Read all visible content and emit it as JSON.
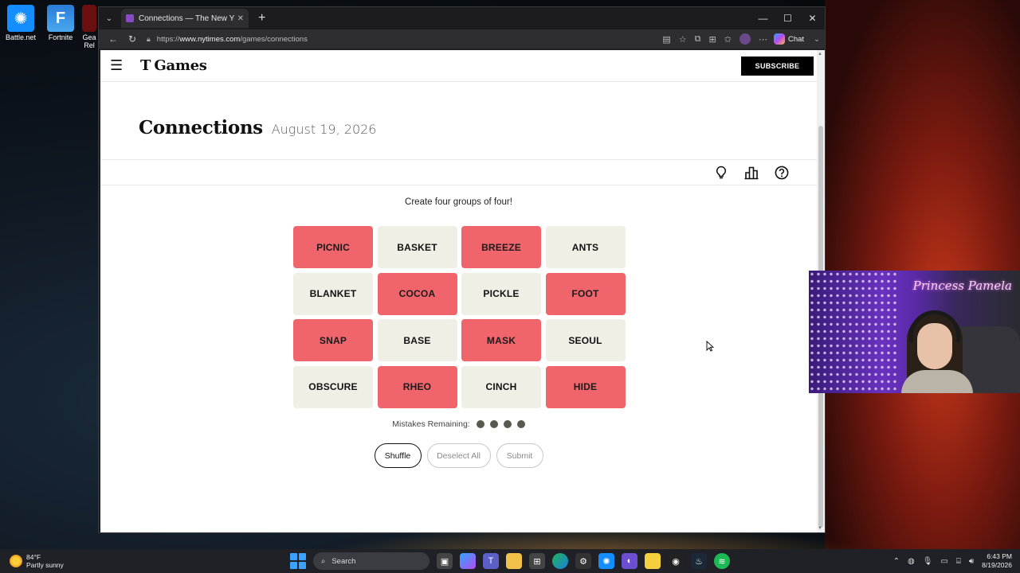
{
  "desktop": {
    "icons": [
      {
        "label": "Battle.net",
        "icon": "battlenet-icon"
      },
      {
        "label": "Fortnite",
        "icon": "fortnite-icon"
      },
      {
        "label": "Gea Rel",
        "icon": "gears-icon"
      }
    ]
  },
  "browser": {
    "tab_title": "Connections — The New York Times",
    "url_prefix": "https://",
    "url_domain": "www.nytimes.com",
    "url_path": "/games/connections",
    "chat_label": "Chat"
  },
  "header": {
    "logo_mark": "T",
    "logo_text": "Games",
    "subscribe_label": "SUBSCRIBE"
  },
  "game": {
    "title": "Connections",
    "date": "August 19, 2026",
    "instructions": "Create four groups of four!",
    "cards": [
      {
        "word": "PICNIC",
        "selected": true
      },
      {
        "word": "BASKET",
        "selected": false
      },
      {
        "word": "BREEZE",
        "selected": true
      },
      {
        "word": "ANTS",
        "selected": false
      },
      {
        "word": "BLANKET",
        "selected": false
      },
      {
        "word": "COCOA",
        "selected": true
      },
      {
        "word": "PICKLE",
        "selected": false
      },
      {
        "word": "FOOT",
        "selected": true
      },
      {
        "word": "SNAP",
        "selected": true
      },
      {
        "word": "BASE",
        "selected": false
      },
      {
        "word": "MASK",
        "selected": true
      },
      {
        "word": "SEOUL",
        "selected": false
      },
      {
        "word": "OBSCURE",
        "selected": false
      },
      {
        "word": "RHEO",
        "selected": true
      },
      {
        "word": "CINCH",
        "selected": false
      },
      {
        "word": "HIDE",
        "selected": true
      }
    ],
    "mistakes_label": "Mistakes Remaining:",
    "mistakes_remaining": 4,
    "shuffle_label": "Shuffle",
    "deselect_label": "Deselect All",
    "submit_label": "Submit",
    "colors": {
      "selected": "#f0656c",
      "unselected": "#efefe6",
      "dot": "#5a594e"
    }
  },
  "webcam": {
    "overlay_name": "Princess Pamela"
  },
  "taskbar": {
    "weather_temp": "84°F",
    "weather_desc": "Partly sunny",
    "search_label": "Search",
    "time": "6:43 PM",
    "date": "8/19/2026"
  }
}
